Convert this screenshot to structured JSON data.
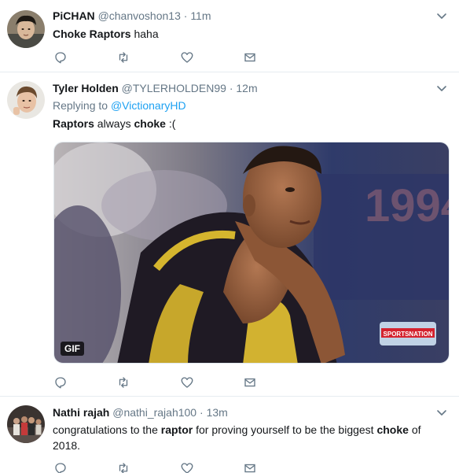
{
  "tweets": [
    {
      "fullname": "PiCHAN",
      "handle": "@chanvoshon13",
      "separator": "·",
      "time": "11m",
      "text_parts": [
        {
          "t": "Choke Raptors",
          "b": true
        },
        {
          "t": " haha",
          "b": false
        }
      ]
    },
    {
      "fullname": "Tyler Holden",
      "handle": "@TYLERHOLDEN99",
      "separator": "·",
      "time": "12m",
      "reply_prefix": "Replying to",
      "reply_to": "@VictionaryHD",
      "text_parts": [
        {
          "t": "Raptors",
          "b": true
        },
        {
          "t": " always ",
          "b": false
        },
        {
          "t": "choke",
          "b": true
        },
        {
          "t": " :(",
          "b": false
        }
      ],
      "media": {
        "badge": "GIF",
        "watermark": "SPORTSNATION",
        "background_text": "1994"
      }
    },
    {
      "fullname": "Nathi rajah",
      "handle": "@nathi_rajah100",
      "separator": "·",
      "time": "13m",
      "text_parts": [
        {
          "t": "congratulations to the ",
          "b": false
        },
        {
          "t": "raptor",
          "b": true
        },
        {
          "t": " for proving yourself to be the biggest ",
          "b": false
        },
        {
          "t": "choke",
          "b": true
        },
        {
          "t": " of 2018.",
          "b": false
        }
      ]
    }
  ],
  "icons": {
    "reply": "reply-icon",
    "retweet": "retweet-icon",
    "like": "like-icon",
    "dm": "direct-message-icon",
    "caret": "chevron-down-icon"
  },
  "colors": {
    "text": "#14171a",
    "secondary": "#657786",
    "link": "#1da1f2",
    "icon": "#657786",
    "divider": "#e6ecf0"
  }
}
